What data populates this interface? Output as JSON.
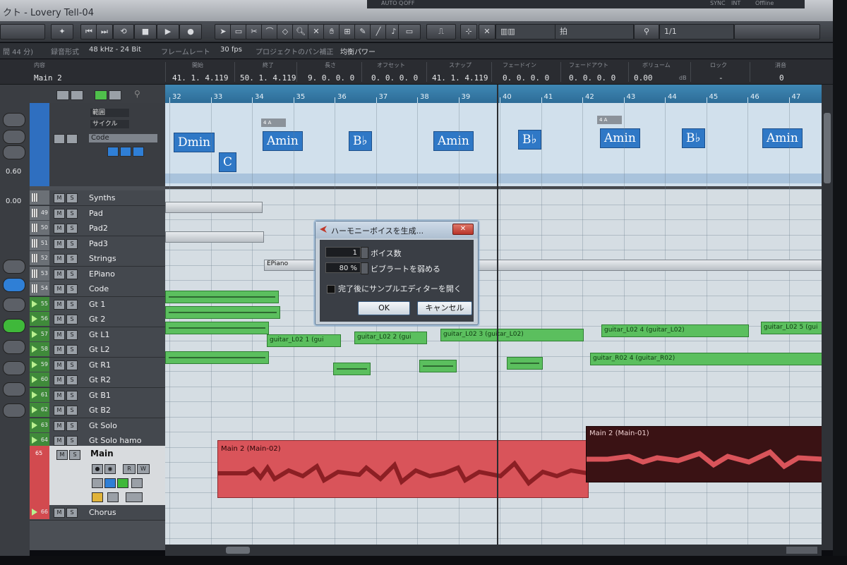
{
  "window": {
    "title": "クト - Lovery Tell-04"
  },
  "top_strip": {
    "auto_q": "AUTO Q",
    "off": "OFF",
    "sync": "SYNC",
    "int": "INT",
    "offline": "Offline"
  },
  "toolbar": {
    "snap_value": "拍",
    "quantize_value": "1/1"
  },
  "info_line": {
    "duration_label": "間 44 分)",
    "record_format_label": "録音形式",
    "record_format_value": "48 kHz - 24 Bit",
    "frame_rate_label": "フレームレート",
    "frame_rate_value": "30 fps",
    "pan_label": "プロジェクトのパン補正",
    "pan_value": "均衡パワー"
  },
  "event_info": {
    "name_header": "内容",
    "name": "Main 2",
    "start_header": "開始",
    "start": "41. 1. 4.119",
    "end_header": "終了",
    "end": "50. 1. 4.119",
    "length_header": "長さ",
    "length": "9. 0. 0. 0",
    "offset_header": "オフセット",
    "offset": "0. 0. 0. 0",
    "snap_header": "スナップ",
    "snap": "41. 1. 4.119",
    "fadein_header": "フェードイン",
    "fadein": "0. 0. 0. 0",
    "fadeout_header": "フェードアウト",
    "fadeout": "0. 0. 0. 0",
    "volume_header": "ボリューム",
    "volume": "0.00",
    "volume_unit": "dB",
    "lock_header": "ロック",
    "lock": "-",
    "mute_header": "消音",
    "mute": "0"
  },
  "left_strip": {
    "value1": "0.60",
    "value2": "0.00"
  },
  "chord_track": {
    "option1": "範囲",
    "option2": "サイクル",
    "name": "Code"
  },
  "tracks": [
    {
      "num": "",
      "name": "Synths",
      "type": "inst"
    },
    {
      "num": "49",
      "name": "Pad",
      "type": "inst"
    },
    {
      "num": "50",
      "name": "Pad2",
      "type": "inst"
    },
    {
      "num": "51",
      "name": "Pad3",
      "type": "inst"
    },
    {
      "num": "52",
      "name": "Strings",
      "type": "inst"
    },
    {
      "num": "53",
      "name": "EPiano",
      "type": "inst"
    },
    {
      "num": "54",
      "name": "Code",
      "type": "inst"
    },
    {
      "num": "55",
      "name": "Gt 1",
      "type": "audio"
    },
    {
      "num": "56",
      "name": "Gt 2",
      "type": "audio"
    },
    {
      "num": "57",
      "name": "Gt L1",
      "type": "audio"
    },
    {
      "num": "58",
      "name": "Gt L2",
      "type": "audio"
    },
    {
      "num": "59",
      "name": "Gt R1",
      "type": "audio"
    },
    {
      "num": "60",
      "name": "Gt R2",
      "type": "audio"
    },
    {
      "num": "61",
      "name": "Gt B1",
      "type": "audio"
    },
    {
      "num": "62",
      "name": "Gt B2",
      "type": "audio"
    },
    {
      "num": "63",
      "name": "Gt Solo",
      "type": "audio"
    },
    {
      "num": "64",
      "name": "Gt Solo hamo",
      "type": "audio"
    }
  ],
  "main_track": {
    "num": "65",
    "name": "Main",
    "r": "R",
    "w": "W"
  },
  "chorus_track": {
    "num": "66",
    "name": "Chorus"
  },
  "track_buttons": {
    "mute": "M",
    "solo": "S"
  },
  "ruler": {
    "bars": [
      "32",
      "33",
      "34",
      "35",
      "36",
      "37",
      "38",
      "39",
      "40",
      "41",
      "42",
      "43",
      "44",
      "45",
      "46",
      "47"
    ]
  },
  "chords": {
    "dmin": "Dmin",
    "c": "C",
    "amin1": "Amin",
    "bb1": "B♭",
    "amin2": "Amin",
    "bb2": "B♭",
    "amin3": "Amin",
    "bb3": "B♭",
    "amin4": "Amin"
  },
  "markers": {
    "m1": "4 A",
    "m2": "4 A"
  },
  "clips": {
    "epiano": "EPiano",
    "l02_1": "guitar_L02 1 (gui",
    "l02_2": "guitar_L02 2 (gui",
    "l02_3": "guitar_L02 3 (guitar_L02)",
    "l02_4": "guitar_L02 4 (guitar_L02)",
    "l02_5": "guitar_L02 5 (gui",
    "r02_4": "guitar_R02 4 (guitar_R02)",
    "main_02": "Main 2 (Main-02)",
    "main_01": "Main 2 (Main-01)"
  },
  "dialog": {
    "title": "ハーモニーボイスを生成...",
    "close": "✕",
    "voices_value": "1",
    "voices_label": "ボイス数",
    "vibrato_value": "80 %",
    "vibrato_label": "ビブラートを弱める",
    "open_editor_label": "完了後にサンプルエディターを開く",
    "ok": "OK",
    "cancel": "キャンセル"
  },
  "colors": {
    "chord": "#2f78c6",
    "audio_clip": "#5bbf5e",
    "main_clip": "#d9545a",
    "ruler": "#3f88b5"
  }
}
